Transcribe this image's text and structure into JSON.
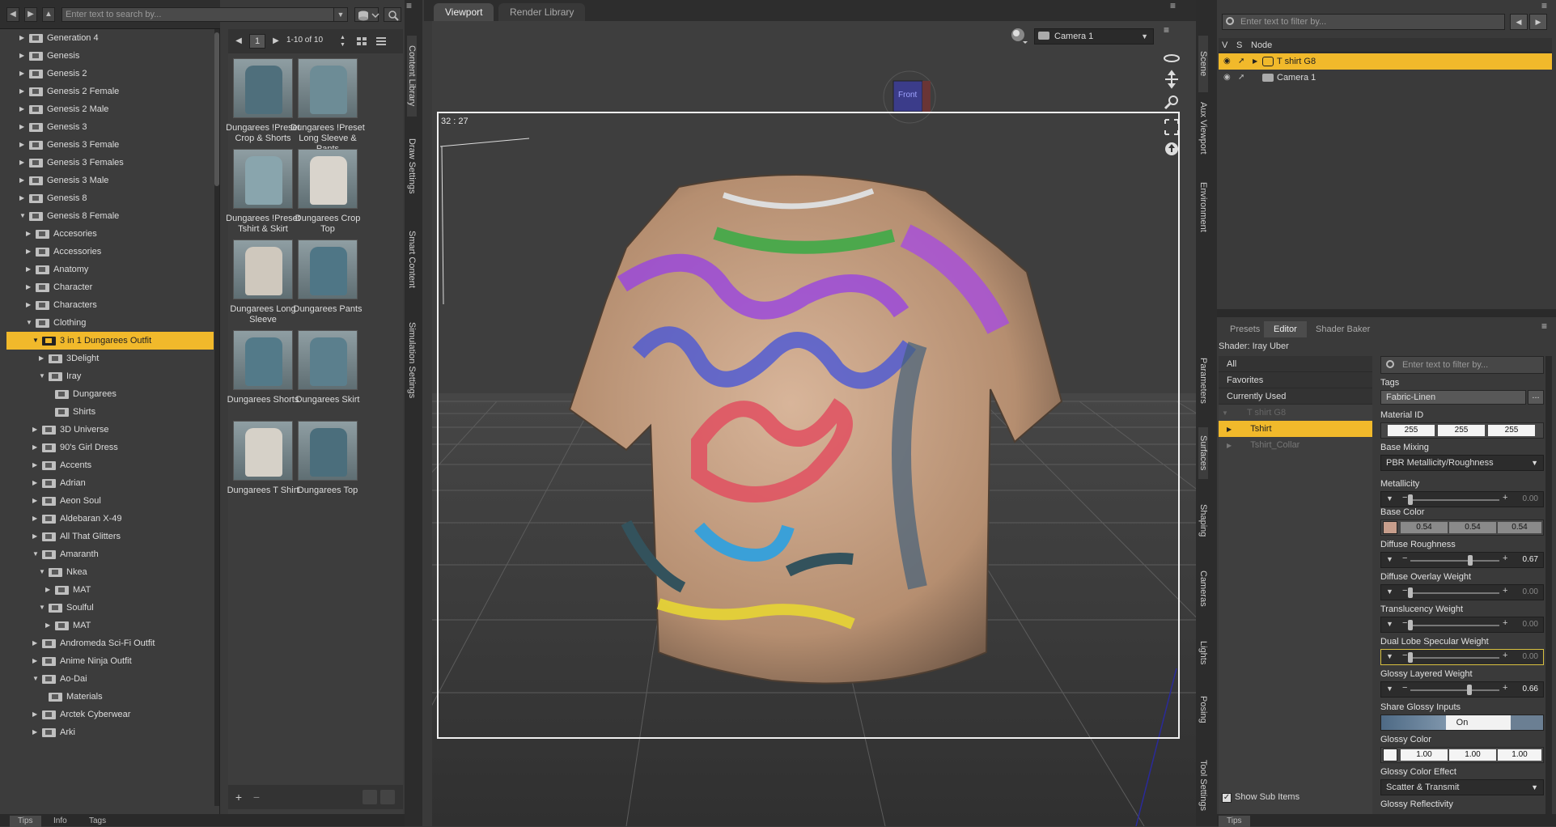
{
  "left": {
    "search_placeholder": "Enter text to search by...",
    "tree": [
      {
        "label": "Generation 4",
        "indent": 0,
        "expanded": false
      },
      {
        "label": "Genesis",
        "indent": 0,
        "expanded": false
      },
      {
        "label": "Genesis 2",
        "indent": 0,
        "expanded": false
      },
      {
        "label": "Genesis 2 Female",
        "indent": 0,
        "expanded": false
      },
      {
        "label": "Genesis 2 Male",
        "indent": 0,
        "expanded": false
      },
      {
        "label": "Genesis 3",
        "indent": 0,
        "expanded": false
      },
      {
        "label": "Genesis 3 Female",
        "indent": 0,
        "expanded": false
      },
      {
        "label": "Genesis 3 Females",
        "indent": 0,
        "expanded": false
      },
      {
        "label": "Genesis 3 Male",
        "indent": 0,
        "expanded": false
      },
      {
        "label": "Genesis 8",
        "indent": 0,
        "expanded": false
      },
      {
        "label": "Genesis 8 Female",
        "indent": 0,
        "expanded": true
      },
      {
        "label": "Accesories",
        "indent": 1,
        "expanded": false
      },
      {
        "label": "Accessories",
        "indent": 1,
        "expanded": false
      },
      {
        "label": "Anatomy",
        "indent": 1,
        "expanded": false
      },
      {
        "label": "Character",
        "indent": 1,
        "expanded": false
      },
      {
        "label": "Characters",
        "indent": 1,
        "expanded": false
      },
      {
        "label": "Clothing",
        "indent": 1,
        "expanded": true
      },
      {
        "label": "3 in 1 Dungarees Outfit",
        "indent": 2,
        "expanded": true,
        "selected": true
      },
      {
        "label": "3Delight",
        "indent": 3,
        "expanded": false
      },
      {
        "label": "Iray",
        "indent": 3,
        "expanded": true
      },
      {
        "label": "Dungarees",
        "indent": 4,
        "leaf": true
      },
      {
        "label": "Shirts",
        "indent": 4,
        "leaf": true
      },
      {
        "label": "3D Universe",
        "indent": 2,
        "expanded": false
      },
      {
        "label": "90's Girl Dress",
        "indent": 2,
        "expanded": false
      },
      {
        "label": "Accents",
        "indent": 2,
        "expanded": false
      },
      {
        "label": "Adrian",
        "indent": 2,
        "expanded": false
      },
      {
        "label": "Aeon Soul",
        "indent": 2,
        "expanded": false
      },
      {
        "label": "Aldebaran X-49",
        "indent": 2,
        "expanded": false
      },
      {
        "label": "All That Glitters",
        "indent": 2,
        "expanded": false
      },
      {
        "label": "Amaranth",
        "indent": 2,
        "expanded": true
      },
      {
        "label": "Nkea",
        "indent": 3,
        "expanded": true
      },
      {
        "label": "MAT",
        "indent": 4,
        "expanded": false
      },
      {
        "label": "Soulful",
        "indent": 3,
        "expanded": true
      },
      {
        "label": "MAT",
        "indent": 4,
        "expanded": false
      },
      {
        "label": "Andromeda Sci-Fi Outfit",
        "indent": 2,
        "expanded": false
      },
      {
        "label": "Anime Ninja Outfit",
        "indent": 2,
        "expanded": false
      },
      {
        "label": "Ao-Dai",
        "indent": 2,
        "expanded": true
      },
      {
        "label": "Materials",
        "indent": 3,
        "leaf": true
      },
      {
        "label": "Arctek Cyberwear",
        "indent": 2,
        "expanded": false
      },
      {
        "label": "Arki",
        "indent": 2,
        "expanded": false
      }
    ],
    "bottom_tabs": [
      "Tips",
      "Info",
      "Tags"
    ]
  },
  "content": {
    "page": "1",
    "range": "1-10 of 10",
    "items": [
      {
        "caption": "Dungarees !Preset Crop & Shorts",
        "kind": "overall-dark"
      },
      {
        "caption": "Dungarees !Preset Long Sleeve & Pants",
        "kind": "overall-long"
      },
      {
        "caption": "Dungarees !Preset Tshirt & Skirt",
        "kind": "overall-skirt"
      },
      {
        "caption": "Dungarees Crop Top",
        "kind": "crop-top"
      },
      {
        "caption": "Dungarees Long Sleeve",
        "kind": "long-sleeve"
      },
      {
        "caption": "Dungarees Pants",
        "kind": "pants"
      },
      {
        "caption": "Dungarees Shorts",
        "kind": "shorts"
      },
      {
        "caption": "Dungarees Skirt",
        "kind": "skirt"
      },
      {
        "caption": "Dungarees T Shirt",
        "kind": "tshirt"
      },
      {
        "caption": "Dungarees Top",
        "kind": "top"
      }
    ]
  },
  "side_tabs_left": [
    "Content Library",
    "Draw Settings",
    "Smart Content",
    "Simulation Settings"
  ],
  "viewport": {
    "tabs": [
      "Viewport",
      "Render Library"
    ],
    "camera": "Camera 1",
    "fps": "32 : 27",
    "cube_label": "Front"
  },
  "side_tabs_right": [
    "Scene",
    "Aux Viewport",
    "Environment",
    "Parameters",
    "Surfaces",
    "Shaping",
    "Cameras",
    "Lights",
    "Posing",
    "Tool Settings"
  ],
  "scene": {
    "filter_placeholder": "Enter text to filter by...",
    "columns": [
      "V",
      "S",
      "Node"
    ],
    "nodes": [
      {
        "label": "T shirt G8",
        "selected": true
      },
      {
        "label": "Camera 1",
        "selected": false
      }
    ]
  },
  "surfaces": {
    "tabs": [
      "Presets",
      "Editor",
      "Shader Baker"
    ],
    "active_tab": "Editor",
    "shader": "Shader: Iray Uber",
    "filter_placeholder": "Enter text to filter by...",
    "groups": [
      "All",
      "Favorites",
      "Currently Used"
    ],
    "tree": [
      {
        "label": "T shirt G8",
        "dim": true
      },
      {
        "label": "Tshirt",
        "selected": true
      },
      {
        "label": "Tshirt_Collar",
        "dim": true
      }
    ],
    "show_sub_items": "Show Sub Items",
    "properties": {
      "tags_label": "Tags",
      "tags_value": "Fabric-Linen",
      "material_id_label": "Material ID",
      "material_id": [
        "255",
        "255",
        "255"
      ],
      "base_mixing_label": "Base Mixing",
      "base_mixing_value": "PBR Metallicity/Roughness",
      "sliders": [
        {
          "label": "Metallicity",
          "value": "0.00",
          "level": 0.0
        },
        {
          "label": "Diffuse Roughness",
          "value": "0.67",
          "level": 0.67
        },
        {
          "label": "Diffuse Overlay Weight",
          "value": "0.00",
          "level": 0.0
        },
        {
          "label": "Translucency Weight",
          "value": "0.00",
          "level": 0.0
        },
        {
          "label": "Dual Lobe Specular Weight",
          "value": "0.00",
          "level": 0.0
        },
        {
          "label": "Glossy Layered Weight",
          "value": "0.66",
          "level": 0.66
        }
      ],
      "base_color_label": "Base Color",
      "base_color": [
        "0.54",
        "0.54",
        "0.54"
      ],
      "share_glossy_label": "Share Glossy Inputs",
      "share_glossy_value": "On",
      "glossy_color_label": "Glossy Color",
      "glossy_color": [
        "1.00",
        "1.00",
        "1.00"
      ],
      "glossy_effect_label": "Glossy Color Effect",
      "glossy_effect_value": "Scatter & Transmit",
      "glossy_reflectivity_label": "Glossy Reflectivity"
    },
    "bottom_tab": "Tips"
  },
  "colors": {
    "accent": "#f1b92b"
  }
}
